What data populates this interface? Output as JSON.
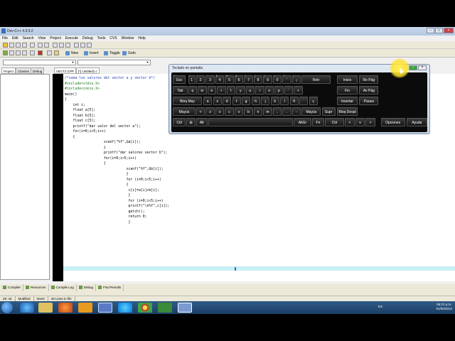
{
  "window": {
    "title": "Dev-C++ 4.9.9.2"
  },
  "menu": [
    "File",
    "Edit",
    "Search",
    "View",
    "Project",
    "Execute",
    "Debug",
    "Tools",
    "CVS",
    "Window",
    "Help"
  ],
  "toolbar": {
    "new_label": "New",
    "insert_label": "Insert",
    "toggle_label": "Toggle",
    "goto_label": "Goto"
  },
  "left_tabs": [
    "Project",
    "Classes",
    "Debug"
  ],
  "editor_tabs": [
    "VECT2.CPP",
    "[*] Untitled1.c"
  ],
  "code": [
    {
      "text": "/*suma los valores del vector a y vector b*/",
      "kind": "cmt"
    },
    {
      "text": "#include<stdio.h>",
      "kind": "pre"
    },
    {
      "text": "#include<conio.h>",
      "kind": "pre"
    },
    {
      "text": "main()",
      "kind": ""
    },
    {
      "text": "{",
      "kind": ""
    },
    {
      "text": "    int i;",
      "kind": ""
    },
    {
      "text": "    float a[5];",
      "kind": ""
    },
    {
      "text": "    float b[5];",
      "kind": ""
    },
    {
      "text": "    float c[5];",
      "kind": ""
    },
    {
      "text": "    printf(\"dar valor del vector a\");",
      "kind": ""
    },
    {
      "text": "    for(i=0;i<5;i++)",
      "kind": ""
    },
    {
      "text": "    {",
      "kind": ""
    },
    {
      "text": "                   scanf(\"%f\",&a[i]);",
      "kind": ""
    },
    {
      "text": "                   }",
      "kind": ""
    },
    {
      "text": "                   printf(\"dar valores vector b\");",
      "kind": ""
    },
    {
      "text": "                   for(i=0;i<5;i++)",
      "kind": ""
    },
    {
      "text": "                   {",
      "kind": ""
    },
    {
      "text": "                              scanf(\"%f\",&b[i]);",
      "kind": ""
    },
    {
      "text": "                              }",
      "kind": ""
    },
    {
      "text": "                              for (i=0;i<5;i++)",
      "kind": ""
    },
    {
      "text": "                              {",
      "kind": ""
    },
    {
      "text": "                               c[i]=a[i]+b[i];",
      "kind": ""
    },
    {
      "text": "                               }",
      "kind": ""
    },
    {
      "text": "                               for (i=0;i<5;i++)",
      "kind": ""
    },
    {
      "text": "                               printf(\"\\n%f\",c[i]);",
      "kind": ""
    },
    {
      "text": "                               getch();",
      "kind": ""
    },
    {
      "text": "                               return 0;",
      "kind": ""
    },
    {
      "text": "                               }",
      "kind": ""
    }
  ],
  "bottom_tabs": [
    "Compiler",
    "Resources",
    "Compile Log",
    "Debug",
    "Find Results"
  ],
  "status": {
    "position": "29: 44",
    "modified": "Modified",
    "mode": "Insert",
    "lines": "28 Lines in file"
  },
  "osk": {
    "title": "Teclado en pantalla",
    "rows": [
      [
        "Esc",
        "1",
        "2",
        "3",
        "4",
        "5",
        "6",
        "7",
        "8",
        "9",
        "0",
        "'",
        "¡",
        "Retr",
        "Inicio",
        "Re Pág"
      ],
      [
        "Tab",
        "q",
        "w",
        "e",
        "r",
        "t",
        "y",
        "u",
        "i",
        "o",
        "p",
        "`",
        "+",
        "Fin",
        "Av Pág"
      ],
      [
        "Bloq May",
        "a",
        "s",
        "d",
        "f",
        "g",
        "h",
        "j",
        "k",
        "l",
        "ñ",
        "´",
        "ç",
        "Insertar",
        "Pausa"
      ],
      [
        "Mayús",
        "<",
        "z",
        "x",
        "c",
        "v",
        "b",
        "n",
        "m",
        ",",
        ".",
        "-",
        "Mayús",
        "Supr",
        "Bloq Despl"
      ],
      [
        "Ctrl",
        "⊞",
        "Alt",
        "",
        "AltGr",
        "Fn",
        "Ctrl",
        "<",
        "v",
        ">",
        "Opciones",
        "Ayuda"
      ]
    ],
    "subs": [
      "ª",
      "!",
      "\"",
      "·",
      "$",
      "%",
      "&",
      "/",
      "(",
      ")",
      "=",
      "?",
      "¿"
    ],
    "impr_pant": "Impr Pant"
  },
  "tray": {
    "lang": "ES",
    "time": "06:21 p.m.",
    "date": "01/05/2012"
  },
  "colors": {
    "editor_bg": "#ffffff",
    "current_line": "#c9f0f5",
    "osk_bg": "#0b0b0b",
    "taskbar": "#1b3f66"
  }
}
